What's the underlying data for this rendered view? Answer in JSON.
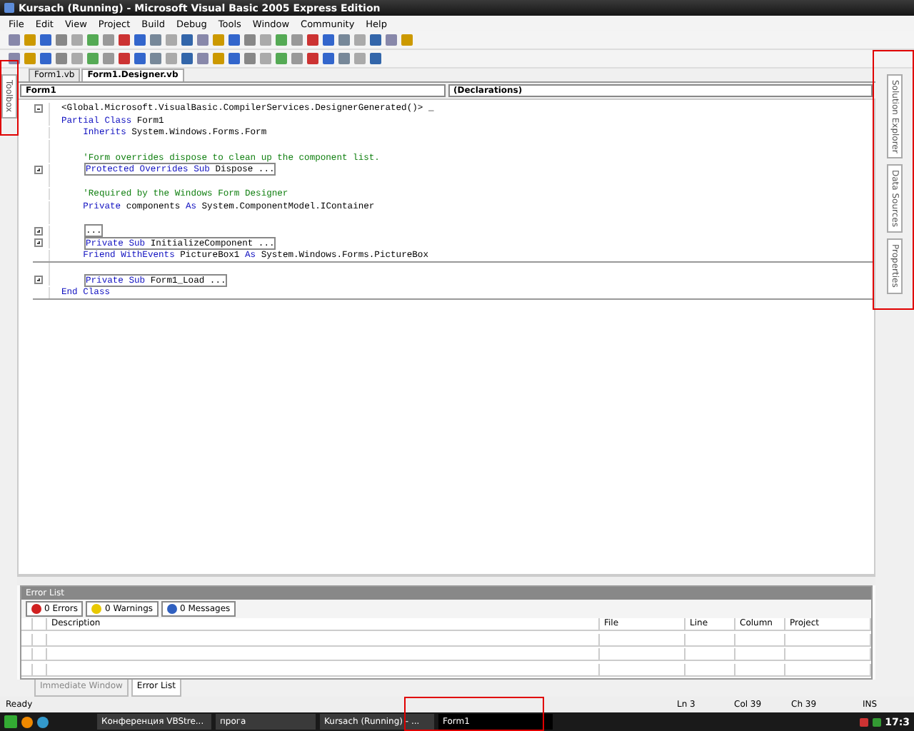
{
  "window": {
    "title": "Kursach (Running) - Microsoft Visual Basic 2005 Express Edition"
  },
  "menu": [
    "File",
    "Edit",
    "View",
    "Project",
    "Build",
    "Debug",
    "Tools",
    "Window",
    "Community",
    "Help"
  ],
  "left_dock": {
    "tabs": [
      "Toolbox"
    ]
  },
  "right_dock": {
    "tabs": [
      "Solution Explorer",
      "Data Sources",
      "Properties"
    ]
  },
  "editor": {
    "tabs": [
      {
        "label": "Form1.vb",
        "selected": false
      },
      {
        "label": "Form1.Designer.vb",
        "selected": true
      }
    ],
    "class_dropdown": "Form1",
    "member_dropdown": "(Declarations)",
    "lines": [
      {
        "kind": "code",
        "toggle": true,
        "expanded": true,
        "collapsed": false,
        "separator_after": false,
        "tokens": [
          {
            "kind": "plain",
            "text": "<Global.Microsoft.VisualBasic.CompilerServices.DesignerGenerated()> _"
          }
        ]
      },
      {
        "kind": "code",
        "toggle": false,
        "collapsed": false,
        "separator_after": false,
        "tokens": [
          {
            "kind": "keyword",
            "text": "Partial Class"
          },
          {
            "kind": "plain",
            "text": " Form1"
          }
        ]
      },
      {
        "kind": "code",
        "toggle": false,
        "collapsed": false,
        "separator_after": false,
        "tokens": [
          {
            "kind": "keyword",
            "text": "    Inherits"
          },
          {
            "kind": "plain",
            "text": " System.Windows.Forms.Form"
          }
        ]
      },
      {
        "kind": "blank",
        "toggle": false,
        "separator_after": false
      },
      {
        "kind": "code",
        "toggle": false,
        "collapsed": false,
        "separator_after": false,
        "tokens": [
          {
            "kind": "comment",
            "text": "    'Form overrides dispose to clean up the component list."
          }
        ]
      },
      {
        "kind": "code",
        "toggle": true,
        "expanded": false,
        "collapsed": true,
        "separator_after": false,
        "tokens": [
          {
            "kind": "keyword",
            "text": "Protected Overrides Sub"
          },
          {
            "kind": "plain",
            "text": " Dispose ..."
          }
        ]
      },
      {
        "kind": "blank",
        "toggle": false,
        "separator_after": false
      },
      {
        "kind": "code",
        "toggle": false,
        "collapsed": false,
        "separator_after": false,
        "tokens": [
          {
            "kind": "comment",
            "text": "    'Required by the Windows Form Designer"
          }
        ]
      },
      {
        "kind": "code",
        "toggle": false,
        "collapsed": false,
        "separator_after": false,
        "tokens": [
          {
            "kind": "keyword",
            "text": "    Private"
          },
          {
            "kind": "plain",
            "text": " components "
          },
          {
            "kind": "keyword",
            "text": "As"
          },
          {
            "kind": "plain",
            "text": " System.ComponentModel.IContainer"
          }
        ]
      },
      {
        "kind": "blank",
        "toggle": false,
        "separator_after": false
      },
      {
        "kind": "code",
        "toggle": true,
        "expanded": false,
        "collapsed": true,
        "separator_after": false,
        "tokens": [
          {
            "kind": "plain",
            "text": "..."
          }
        ]
      },
      {
        "kind": "code",
        "toggle": true,
        "expanded": false,
        "collapsed": true,
        "separator_after": false,
        "tokens": [
          {
            "kind": "keyword",
            "text": "Private Sub"
          },
          {
            "kind": "plain",
            "text": " InitializeComponent ..."
          }
        ]
      },
      {
        "kind": "code",
        "toggle": false,
        "collapsed": false,
        "separator_after": true,
        "tokens": [
          {
            "kind": "keyword",
            "text": "    Friend WithEvents"
          },
          {
            "kind": "plain",
            "text": " PictureBox1 "
          },
          {
            "kind": "keyword",
            "text": "As"
          },
          {
            "kind": "plain",
            "text": " System.Windows.Forms.PictureBox"
          }
        ]
      },
      {
        "kind": "blank",
        "toggle": false,
        "separator_after": false
      },
      {
        "kind": "code",
        "toggle": true,
        "expanded": false,
        "collapsed": true,
        "separator_after": false,
        "tokens": [
          {
            "kind": "keyword",
            "text": "Private Sub"
          },
          {
            "kind": "plain",
            "text": " Form1_Load ..."
          }
        ]
      },
      {
        "kind": "code",
        "toggle": false,
        "collapsed": false,
        "separator_after": true,
        "tokens": [
          {
            "kind": "keyword",
            "text": "End Class"
          }
        ]
      }
    ]
  },
  "error_list": {
    "title": "Error List",
    "filters": [
      {
        "kind": "error",
        "label": "0 Errors",
        "selected": true
      },
      {
        "kind": "warning",
        "label": "0 Warnings",
        "selected": true
      },
      {
        "kind": "message",
        "label": "0 Messages",
        "selected": true
      }
    ],
    "columns": [
      "Description",
      "File",
      "Line",
      "Column",
      "Project"
    ]
  },
  "bottom_tabs": [
    {
      "label": "Immediate Window",
      "selected": false
    },
    {
      "label": "Error List",
      "selected": true
    }
  ],
  "status_bar": {
    "message": "Ready",
    "line": "Ln 3",
    "column": "Col 39",
    "char": "Ch 39",
    "mode": "INS"
  },
  "taskbar": {
    "items": [
      {
        "label": "Конференция VBStre...",
        "selected": false
      },
      {
        "label": "прога",
        "selected": false
      },
      {
        "label": "Kursach (Running) - ...",
        "selected": false
      },
      {
        "label": "Form1",
        "selected": true
      }
    ],
    "clock": "17:3"
  }
}
